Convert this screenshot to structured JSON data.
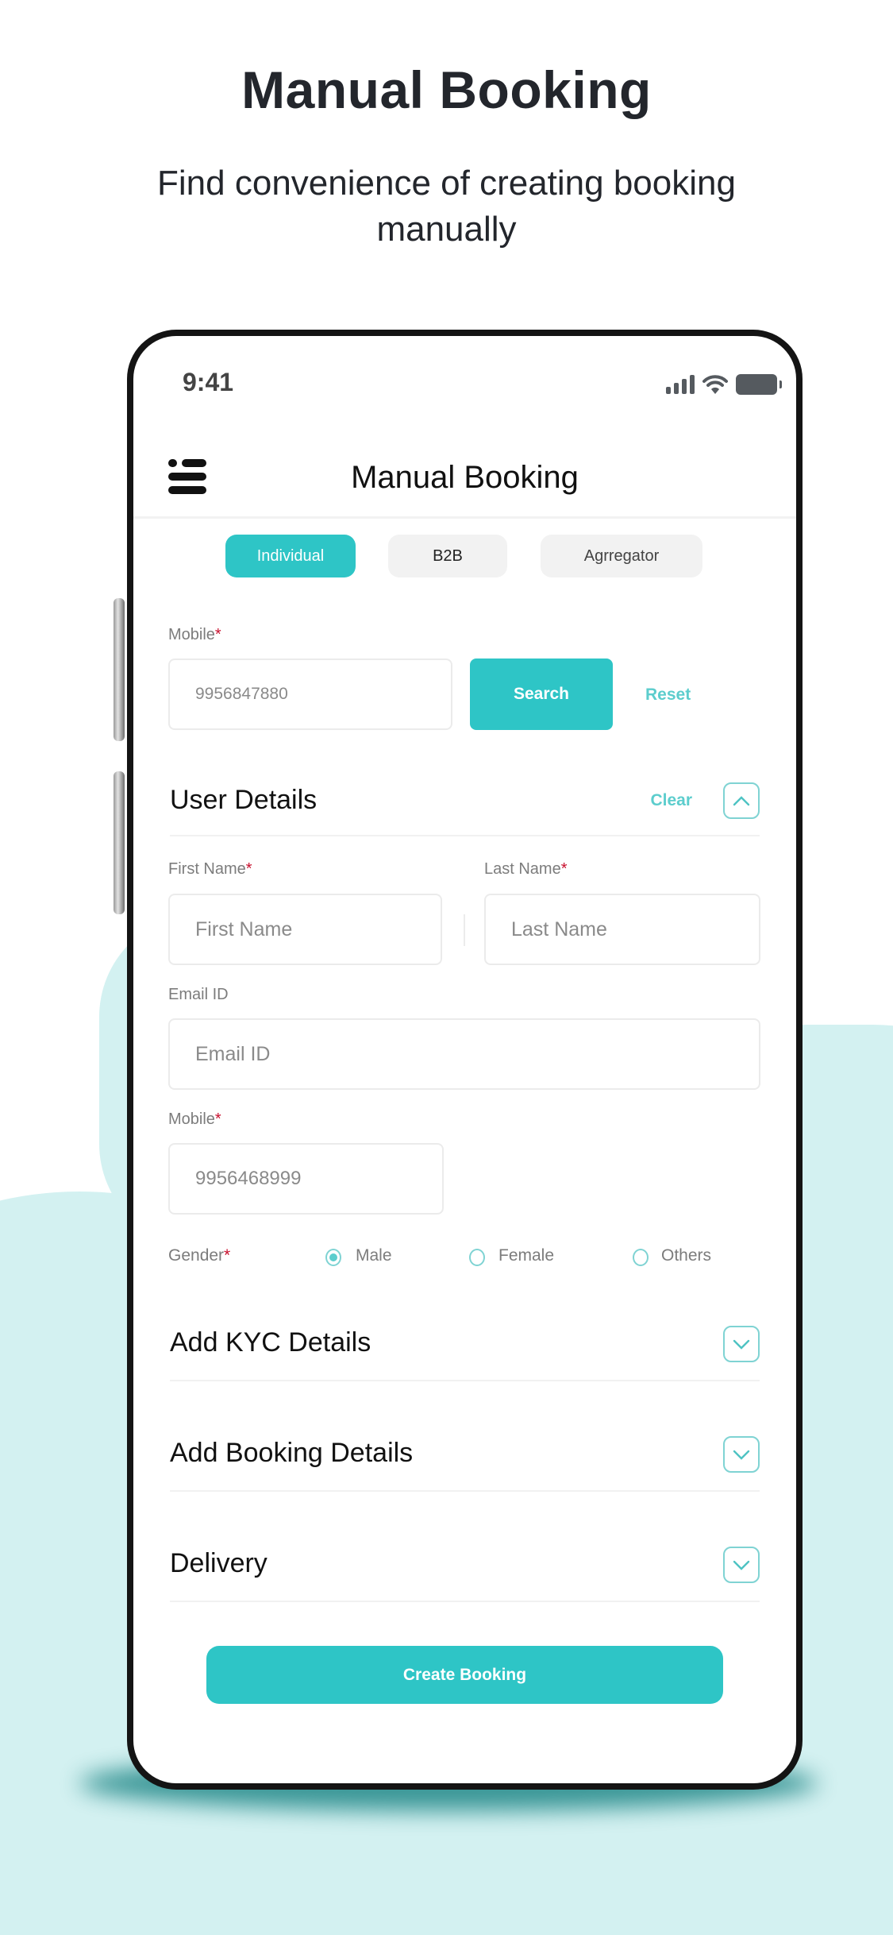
{
  "hero": {
    "title": "Manual Booking",
    "subtitle": "Find convenience of creating booking manually"
  },
  "status_bar": {
    "time": "9:41",
    "icons": [
      "signal-icon",
      "wifi-icon",
      "battery-icon"
    ]
  },
  "header": {
    "menu_icon": "hamburger-menu-icon",
    "title": "Manual Booking"
  },
  "booking_types": {
    "selected": "Individual",
    "tabs": [
      {
        "label": "Individual",
        "active": true
      },
      {
        "label": "B2B",
        "active": false
      },
      {
        "label": "Agrregator",
        "active": false
      }
    ]
  },
  "search": {
    "label": "Mobile",
    "required_mark": "*",
    "value": "9956847880",
    "search_label": "Search",
    "reset_label": "Reset"
  },
  "user_details": {
    "title": "User Details",
    "clear_label": "Clear",
    "toggle_icon": "chevron-up-icon",
    "expanded": true,
    "first_name": {
      "label": "First Name",
      "required_mark": "*",
      "placeholder": "First Name"
    },
    "last_name": {
      "label": "Last Name",
      "required_mark": "*",
      "placeholder": "Last Name"
    },
    "email": {
      "label": "Email ID",
      "placeholder": "Email ID"
    },
    "mobile": {
      "label": "Mobile",
      "required_mark": "*",
      "value": "9956468999"
    },
    "gender": {
      "label": "Gender",
      "required_mark": "*",
      "selected": "Male",
      "options": [
        {
          "label": "Male",
          "checked": true
        },
        {
          "label": "Female",
          "checked": false
        },
        {
          "label": "Others",
          "checked": false
        }
      ]
    }
  },
  "sections": [
    {
      "title": "Add KYC Details",
      "icon": "chevron-down-icon",
      "expanded": false
    },
    {
      "title": "Add Booking Details",
      "icon": "chevron-down-icon",
      "expanded": false
    },
    {
      "title": "Delivery",
      "icon": "chevron-down-icon",
      "expanded": false
    }
  ],
  "actions": {
    "create_label": "Create Booking"
  },
  "colors": {
    "accent": "#2ec5c6",
    "accent_light": "#5ccdcd",
    "background_blob": "#d3f1f1",
    "required": "#c8102e"
  }
}
